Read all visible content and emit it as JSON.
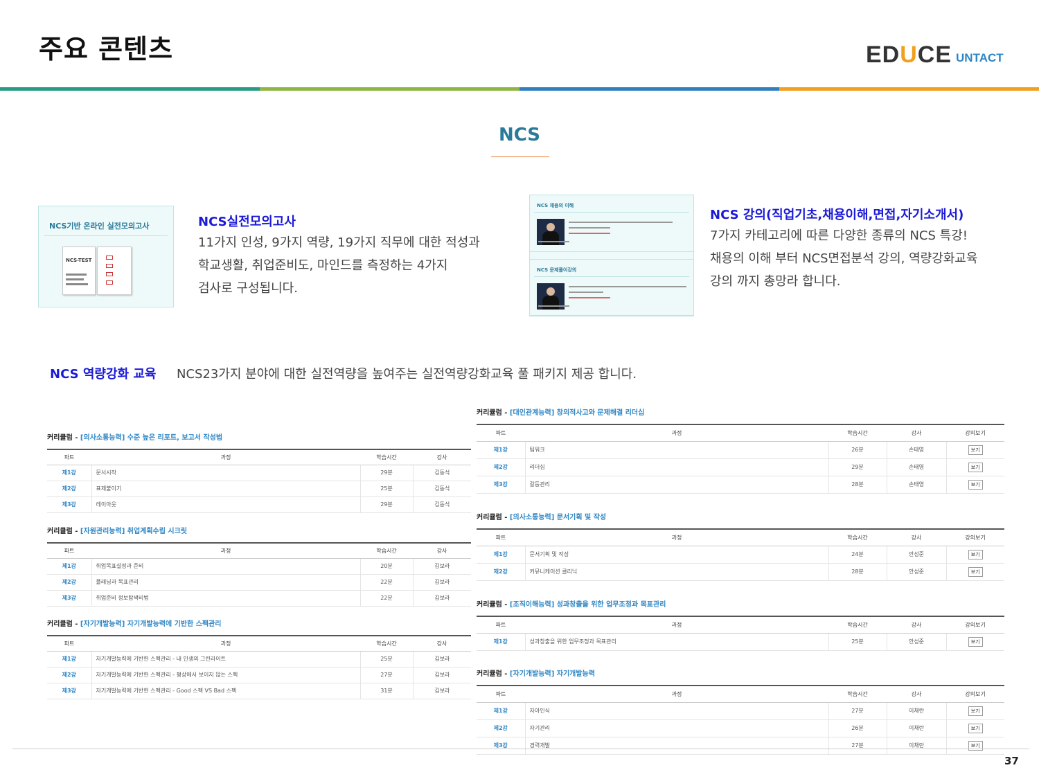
{
  "header": {
    "title": "주요 콘텐츠",
    "logo_brand_left": "ED",
    "logo_brand_u": "U",
    "logo_brand_right": "CE",
    "logo_sub": "UNTACT"
  },
  "colors": {
    "bar": [
      "#2a9a86",
      "#8fb545",
      "#2f7fc1",
      "#f0a01e"
    ],
    "title_blue": "#1a1ad8",
    "heading_teal": "#2a7a9a"
  },
  "section": {
    "heading": "NCS"
  },
  "thumb1": {
    "title": "NCS기반 온라인 실전모의고사",
    "book_label": "NCS-TEST"
  },
  "thumb2": {
    "panel1_title": "NCS 채용의 이해",
    "panel2_title": "NCS 문제풀이강의"
  },
  "block1": {
    "title": "NCS실전모의고사",
    "lines": [
      "11가지 인성, 9가지 역량, 19가지 직무에 대한 적성과",
      "학교생활, 취업준비도, 마인드를 측정하는 4가지",
      "검사로 구성됩니다."
    ]
  },
  "block2": {
    "title": "NCS 강의(직업기초,채용이해,면접,자기소개서)",
    "lines": [
      "7가지 카테고리에 따른 다양한 종류의 NCS 특강!",
      "채용의 이해 부터 NCS면접분석 강의, 역량강화교육",
      "강의 까지 총망라 합니다."
    ]
  },
  "edu": {
    "title": "NCS 역량강화 교육",
    "text": "NCS23가지 분야에 대한 실전역량을 높여주는 실전역량강화교육 풀 패키지 제공 합니다."
  },
  "curriculum_label": "커리큘럼 - ",
  "left_headers": [
    "파트",
    "과정",
    "학습시간",
    "강사"
  ],
  "right_headers": [
    "파트",
    "과정",
    "학습시간",
    "강사",
    "강의보기"
  ],
  "view_label": "보기",
  "left_curricula": [
    {
      "sub": "[의사소통능력] 수준 높은 리포트, 보고서 작성법",
      "rows": [
        {
          "part": "제1강",
          "course": "문서시작",
          "time": "29분",
          "inst": "김동석"
        },
        {
          "part": "제2강",
          "course": "표제붙이기",
          "time": "25분",
          "inst": "김동석"
        },
        {
          "part": "제3강",
          "course": "레이아웃",
          "time": "29분",
          "inst": "김동석"
        }
      ]
    },
    {
      "sub": "[자원관리능력] 취업계획수립 시크릿",
      "rows": [
        {
          "part": "제1강",
          "course": "취업목표설정과 준비",
          "time": "20분",
          "inst": "김보라"
        },
        {
          "part": "제2강",
          "course": "플래닝과 목표관리",
          "time": "22분",
          "inst": "김보라"
        },
        {
          "part": "제3강",
          "course": "취업준비 정보탐색비법",
          "time": "22분",
          "inst": "김보라"
        }
      ]
    },
    {
      "sub": "[자기개발능력] 자기개발능력에 기반한 스펙관리",
      "rows": [
        {
          "part": "제1강",
          "course": "자기개발능력에 기반한 스펙관리 - 내 인생의 그린라이트",
          "time": "25분",
          "inst": "김보라"
        },
        {
          "part": "제2강",
          "course": "자기개발능력에 기반한 스펙관리 - 평상에서 보이지 않는 스펙",
          "time": "27분",
          "inst": "김보라"
        },
        {
          "part": "제3강",
          "course": "자기개발능력에 기반한 스펙관리 - Good 스펙 VS Bad 스펙",
          "time": "31분",
          "inst": "김보라"
        }
      ]
    }
  ],
  "right_curricula": [
    {
      "sub": "[대인관계능력] 창의적사고와 문제해결 리더십",
      "rows": [
        {
          "part": "제1강",
          "course": "팀워크",
          "time": "26분",
          "inst": "손태영"
        },
        {
          "part": "제2강",
          "course": "리더십",
          "time": "29분",
          "inst": "손태영"
        },
        {
          "part": "제3강",
          "course": "갈등관리",
          "time": "28분",
          "inst": "손태영"
        }
      ]
    },
    {
      "sub": "[의사소통능력] 문서기획 및 작성",
      "rows": [
        {
          "part": "제1강",
          "course": "문서기획 및 작성",
          "time": "24분",
          "inst": "안성준"
        },
        {
          "part": "제2강",
          "course": "커뮤니케이션 클리닉",
          "time": "28분",
          "inst": "안성준"
        }
      ]
    },
    {
      "sub": "[조직이해능력] 성과창출을 위한 업무조정과 목표관리",
      "rows": [
        {
          "part": "제1강",
          "course": "성과창출을 위한 업무조정과 목표관리",
          "time": "25분",
          "inst": "안성준"
        }
      ]
    },
    {
      "sub": "[자기개발능력] 자기개발능력",
      "rows": [
        {
          "part": "제1강",
          "course": "자아인식",
          "time": "27분",
          "inst": "이채란"
        },
        {
          "part": "제2강",
          "course": "자기관리",
          "time": "26분",
          "inst": "이채란"
        },
        {
          "part": "제3강",
          "course": "경력개발",
          "time": "27분",
          "inst": "이채란"
        }
      ]
    }
  ],
  "page_number": "37"
}
